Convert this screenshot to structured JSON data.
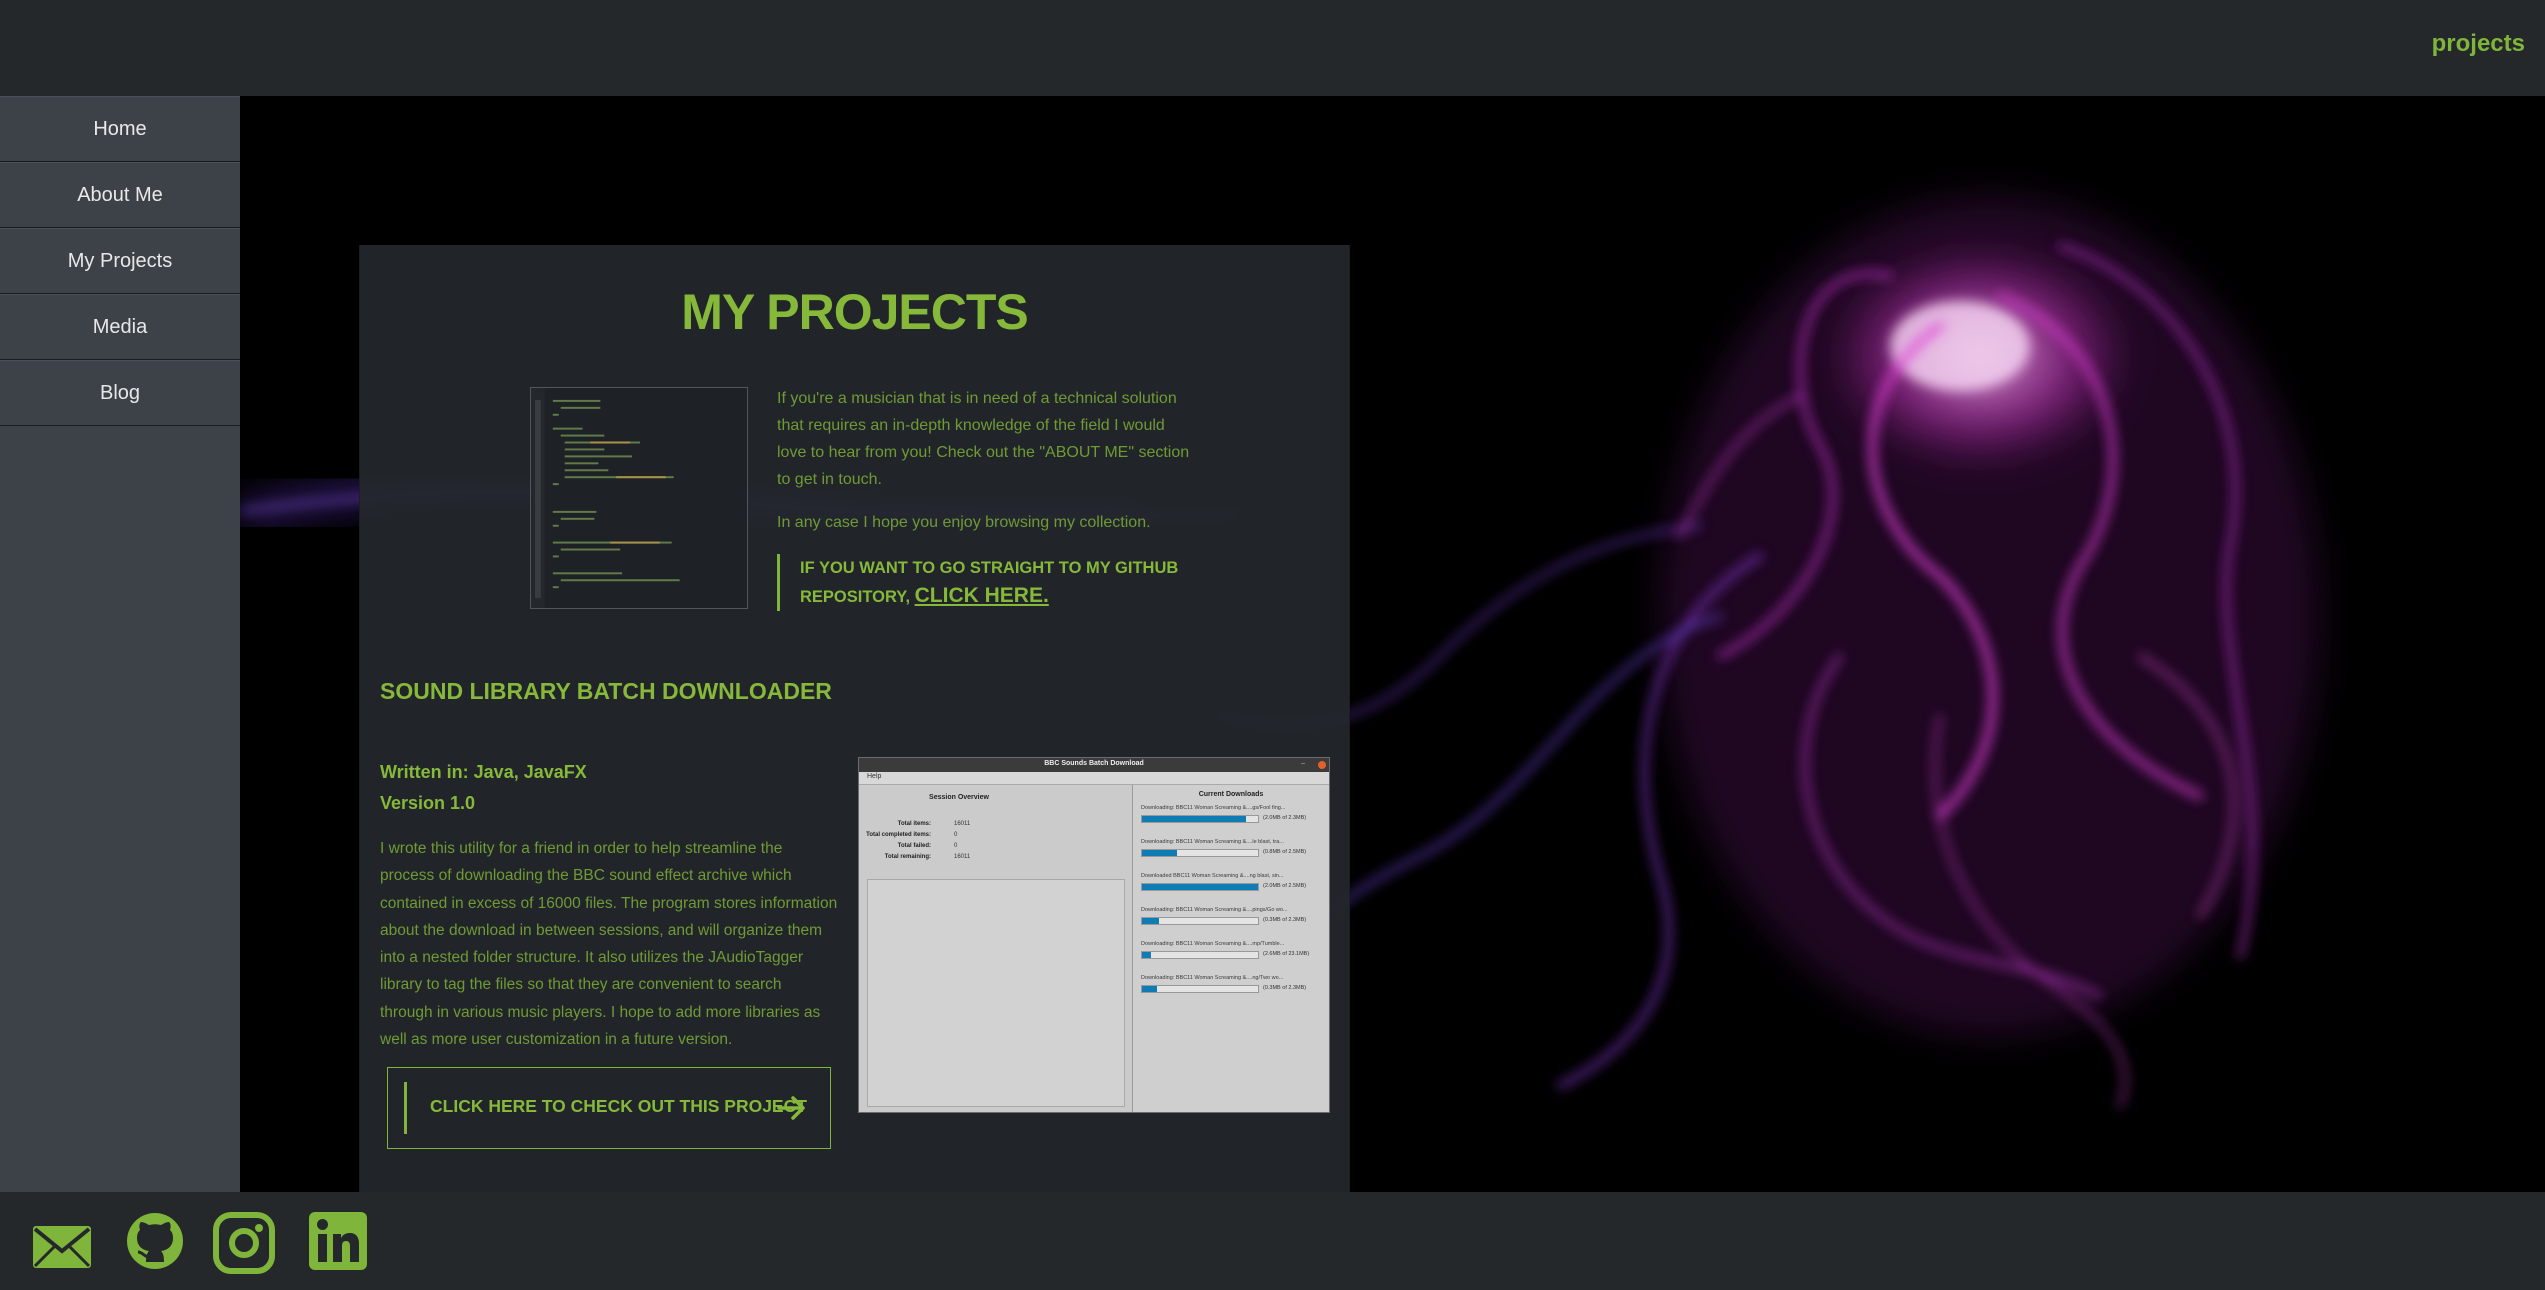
{
  "header": {
    "page_label": "projects"
  },
  "sidebar": {
    "items": [
      {
        "label": "Home"
      },
      {
        "label": "About Me"
      },
      {
        "label": "My Projects"
      },
      {
        "label": "Media"
      },
      {
        "label": "Blog"
      }
    ]
  },
  "main": {
    "title": "MY PROJECTS",
    "intro_paragraph_1": "If you're a musician that is in need of a technical solution that requires an in-depth knowledge of the field I would love to hear from you! Check out the \"ABOUT ME\" section to get in touch.",
    "intro_paragraph_2": "In any case I hope you enjoy browsing my collection.",
    "callout_text": "IF YOU WANT TO GO STRAIGHT TO MY GITHUB REPOSITORY,",
    "callout_link": "CLICK HERE.",
    "project": {
      "title": "SOUND LIBRARY BATCH DOWNLOADER",
      "written_in": "Written in: Java, JavaFX",
      "version": "Version 1.0",
      "description": "I wrote this utility for a friend in order to help streamline the process of downloading the BBC sound effect archive which contained in excess of 16000 files. The program stores information about the download in between sessions, and will organize them into a nested folder structure. It also utilizes the JAudioTagger library to tag the files so that they are convenient to search through in various music players. I hope to add more libraries as well as more user customization in a future version.",
      "cta_label": "CLICK HERE TO CHECK OUT THIS PROJECT",
      "screenshot": {
        "window_title": "BBC Sounds Batch Download",
        "menu": "Help",
        "left_heading": "Session Overview",
        "stats": [
          {
            "label": "Total items:",
            "value": "16011"
          },
          {
            "label": "Total completed items:",
            "value": "0"
          },
          {
            "label": "Total failed:",
            "value": "0"
          },
          {
            "label": "Total remaining:",
            "value": "16011"
          }
        ],
        "right_heading": "Current Downloads",
        "downloads": [
          {
            "name": "Downloading: BBC11 Woman Screaming &....gs/Fool fing...",
            "size": "(2.0MB of 2.3MB)",
            "progress": 0.9
          },
          {
            "name": "Downloading: BBC11 Woman Screaming &....le blast, tra...",
            "size": "(0.8MB of 2.5MB)",
            "progress": 0.3
          },
          {
            "name": "Downloaded BBC11 Woman Screaming &....ng blast, sin...",
            "size": "(2.0MB of 2.5MB)",
            "progress": 1.0
          },
          {
            "name": "Downloading: BBC11 Woman Screaming &....pings/Go wo...",
            "size": "(0.3MB of 2.3MB)",
            "progress": 0.15
          },
          {
            "name": "Downloading: BBC11 Woman Screaming &....mp/Tumble...",
            "size": "(2.6MB of 23.1MB)",
            "progress": 0.08
          },
          {
            "name": "Downloading: BBC11 Woman Screaming &....ng/Two wo...",
            "size": "(0.3MB of 2.3MB)",
            "progress": 0.13
          }
        ]
      }
    }
  },
  "footer": {
    "icons": [
      "mail-icon",
      "github-icon",
      "instagram-icon",
      "linkedin-icon"
    ]
  },
  "colors": {
    "accent": "#7fb53a",
    "panel": "#24282c",
    "sidebar": "#3d4249"
  }
}
